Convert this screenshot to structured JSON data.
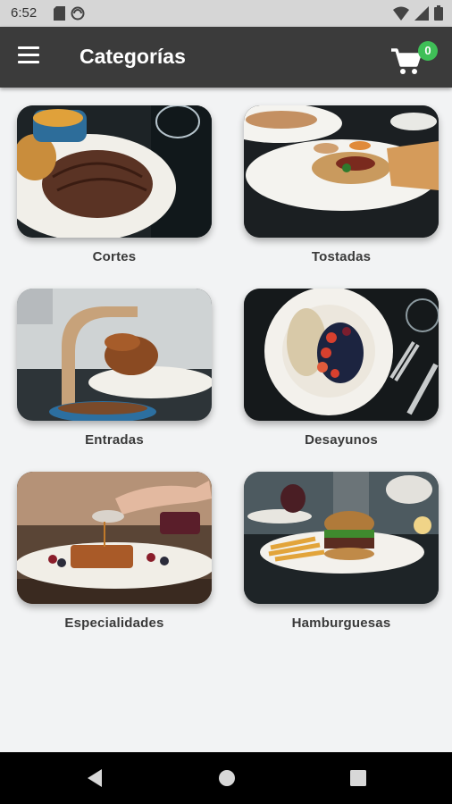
{
  "status_bar": {
    "time": "6:52"
  },
  "app_bar": {
    "title": "Categorías",
    "cart_count": "0"
  },
  "categories": [
    {
      "label": "Cortes"
    },
    {
      "label": "Tostadas"
    },
    {
      "label": "Entradas"
    },
    {
      "label": "Desayunos"
    },
    {
      "label": "Especialidades"
    },
    {
      "label": "Hamburguesas"
    }
  ],
  "icons": {
    "menu": "menu-icon",
    "cart": "shopping-cart-icon",
    "back": "back-triangle-icon",
    "home": "home-circle-icon",
    "recents": "recents-square-icon"
  },
  "colors": {
    "app_bar": "#3b3b3b",
    "badge": "#3fbf57",
    "background": "#f2f3f4"
  }
}
